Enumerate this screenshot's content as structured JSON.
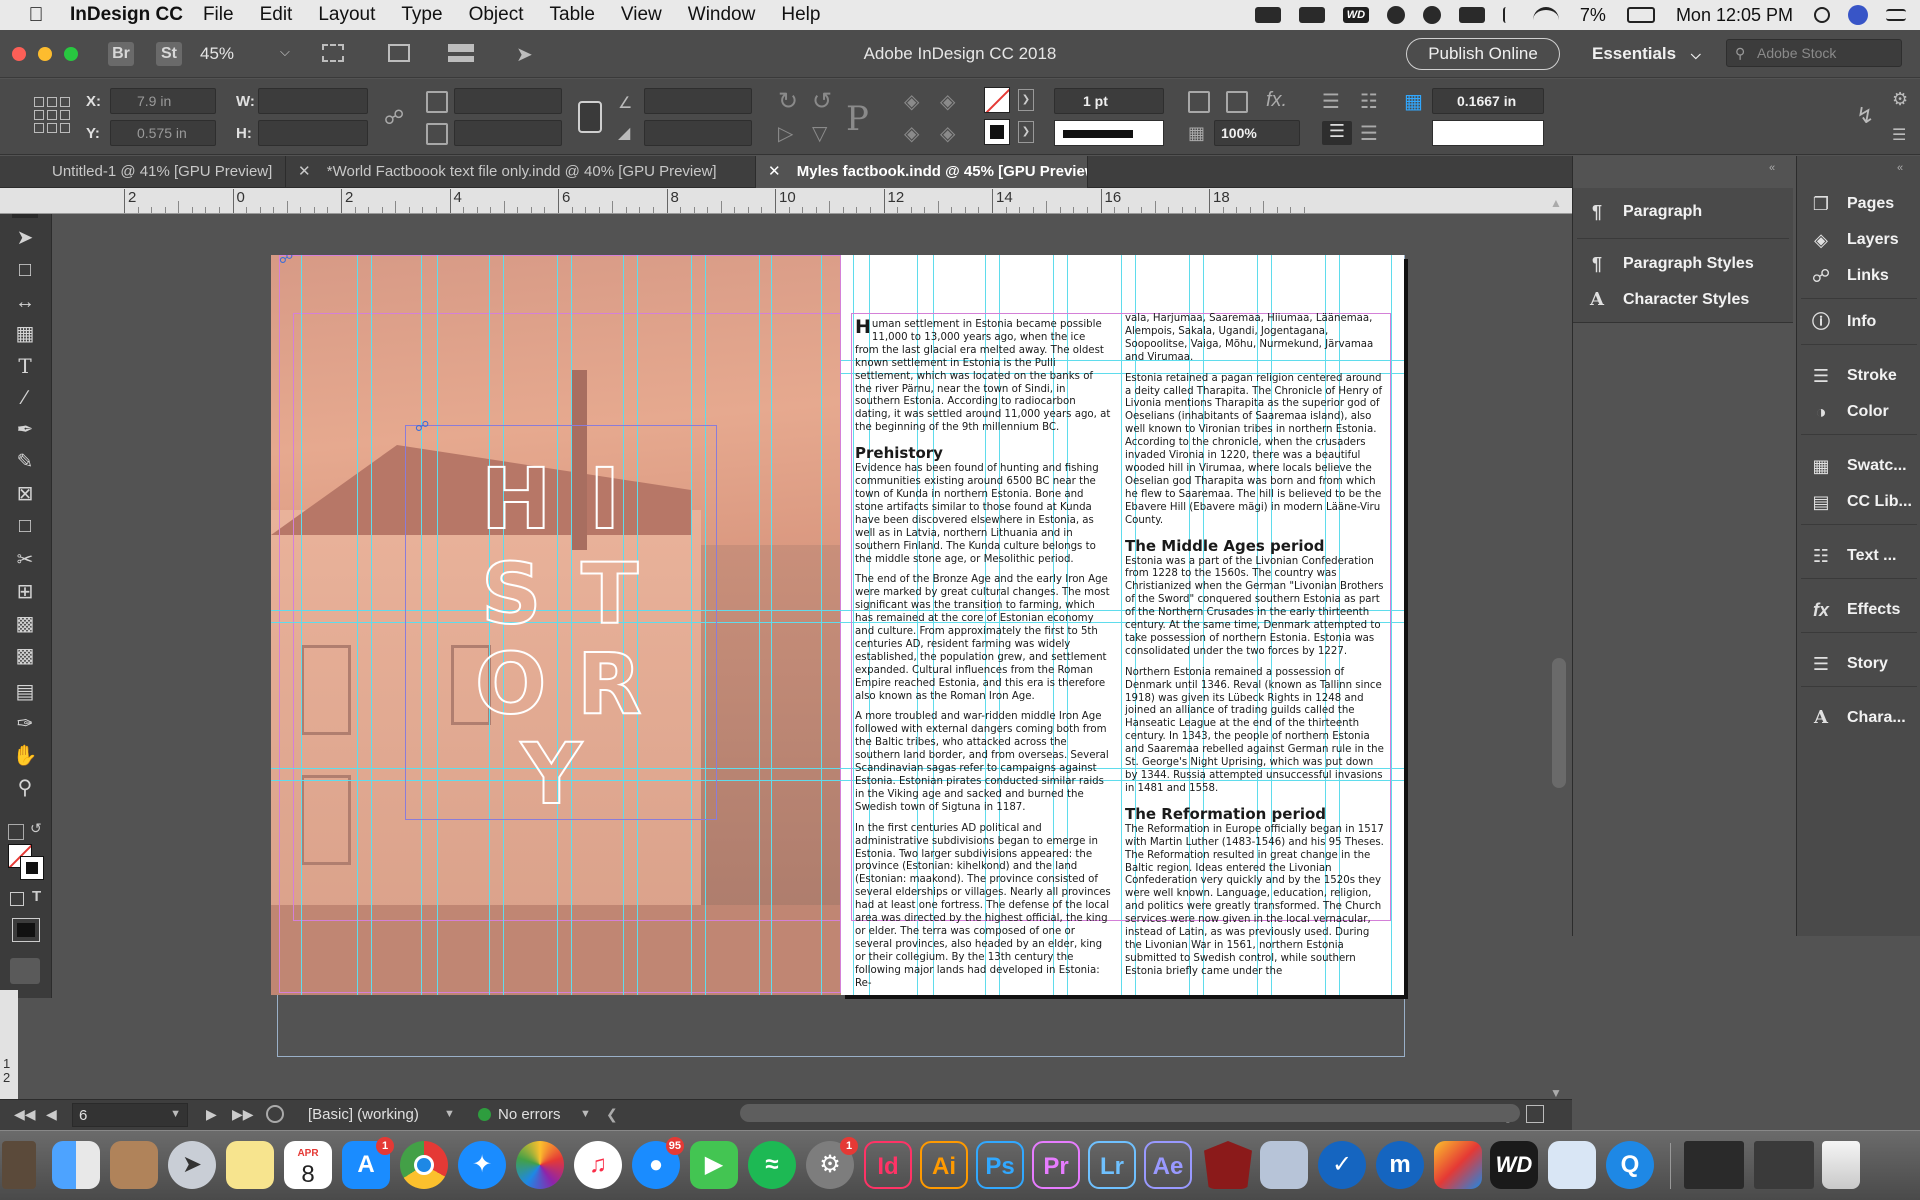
{
  "menubar": {
    "app_name": "InDesign CC",
    "items": [
      "File",
      "Edit",
      "Layout",
      "Type",
      "Object",
      "Table",
      "View",
      "Window",
      "Help"
    ],
    "battery": "7%",
    "clock": "Mon 12:05 PM",
    "wd_label": "WD"
  },
  "titlebar": {
    "bridge": "Br",
    "stock_btn": "St",
    "zoom": "45%",
    "title": "Adobe InDesign CC 2018",
    "publish": "Publish Online",
    "workspace": "Essentials",
    "search_placeholder": "Adobe Stock"
  },
  "control": {
    "x_label": "X:",
    "x_value": "7.9 in",
    "y_label": "Y:",
    "y_value": "0.575 in",
    "w_label": "W:",
    "h_label": "H:",
    "stroke_weight": "1 pt",
    "scale": "100%",
    "gutter": "0.1667 in"
  },
  "tabs": [
    {
      "label": "Untitled-1 @ 41% [GPU Preview]",
      "active": false
    },
    {
      "label": "*World Factboook text file only.indd @ 40% [GPU Preview]",
      "active": false
    },
    {
      "label": "Myles factbook.indd @ 45% [GPU Preview]",
      "active": true
    }
  ],
  "ruler": {
    "labels": [
      "2",
      "0",
      "2",
      "4",
      "6",
      "8",
      "10",
      "12",
      "14",
      "16",
      "18"
    ],
    "vertical_labels": [
      "1",
      "2"
    ]
  },
  "page": {
    "history_letters": [
      "H",
      "I",
      "S",
      "T",
      "O",
      "R",
      "Y"
    ],
    "col1": {
      "dropcap": "H",
      "intro": "uman settlement in Estonia became possible 11,000 to 13,000 years ago, when the ice from the last glacial era melted away. The oldest known settlement in Estonia is the Pulli settlement, which was located on the banks of the river Pärnu, near the town of Sindi, in southern Estonia. According to radiocarbon dating, it was settled around 11,000 years ago, at the beginning of the 9th millennium BC.",
      "h_prehistory": "Prehistory",
      "p1": "Evidence has been found of hunting and fishing communities existing around 6500 BC near the town of Kunda in northern Estonia. Bone and stone artifacts similar to those found at Kunda have been discovered elsewhere in Estonia, as well as in Latvia, northern Lithuania and in southern Finland. The Kunda culture belongs to the middle stone age, or Mesolithic period.",
      "p2": "The end of the Bronze Age and the early Iron Age were marked by great cultural changes. The most significant was the transition to farming, which has remained at the core of Estonian economy and culture. From approximately the first to 5th centuries AD, resident farming was widely established, the population grew, and settlement expanded. Cultural influences from the Roman Empire reached Estonia, and this era is therefore also known as the Roman Iron Age.",
      "p3": "A more troubled and war-ridden middle Iron Age followed with external dangers coming both from the Baltic tribes, who attacked across the southern land border, and from overseas. Several Scandinavian sagas refer to campaigns against Estonia. Estonian pirates conducted similar raids in the Viking age and sacked and burned the Swedish town of Sigtuna in 1187.",
      "p4": "In the first centuries AD political and administrative subdivisions began to emerge in Estonia. Two larger subdivisions appeared: the province (Estonian: kihelkond) and the land (Estonian: maakond). The province consisted of several elderships or villages. Nearly all provinces had at least one fortress. The defense of the local area was directed by the highest official, the king or elder. The terra was composed of one or several provinces, also headed by an elder, king or their collegium. By the 13th century the following major lands had developed in Estonia: Re-"
    },
    "col2": {
      "p0": "vala, Harjumaa, Saaremaa, Hiiumaa, Läänemaa, Alempois, Sakala, Ugandi, Jogentagana, Soopoolitse, Vaiga, Mõhu, Nurmekund, Järvamaa and Virumaa.",
      "p1": "Estonia retained a pagan religion centered around a deity called Tharapita. The Chronicle of Henry of Livonia mentions Tharapita as the superior god of Oeselians (inhabitants of Saaremaa island), also well known to Vironian tribes in northern Estonia. According to the chronicle, when the crusaders invaded Vironia in 1220, there was a beautiful wooded hill in Virumaa, where locals believe the Oeselian god Tharapita was born and from which he flew to Saaremaa. The hill is believed to be the Ebavere Hill (Ebavere mägi) in modern Lääne-Viru County.",
      "h_middle": "The Middle Ages period",
      "p2": "Estonia was a part of the Livonian Confederation from 1228 to the 1560s. The country was Christianized when the German \"Livonian Brothers of the Sword\" conquered southern Estonia as part of the Northern Crusades in the early thirteenth century. At the same time, Denmark attempted to take possession of northern Estonia. Estonia was consolidated under the two forces by 1227.",
      "p3": "Northern Estonia remained a possession of Denmark until 1346. Reval (known as Tallinn since 1918) was given its Lübeck Rights in 1248 and joined an alliance of trading guilds called the Hanseatic League at the end of the thirteenth century. In 1343, the people of northern Estonia and Saaremaa rebelled against German rule in the St. George's Night Uprising, which was put down by 1344. Russia attempted unsuccessful invasions in 1481 and 1558.",
      "h_reform": "The Reformation period",
      "p4": "The Reformation in Europe officially began in 1517 with Martin Luther (1483-1546) and his 95 Theses. The Reformation resulted in great change in the Baltic region. Ideas entered the Livonian Confederation very quickly and by the 1520s they were well known. Language, education, religion, and politics were greatly transformed. The Church services were now given in the local vernacular, instead of Latin, as was previously used. During the Livonian War in 1561, northern Estonia submitted to Swedish control, while southern Estonia briefly came under the"
    }
  },
  "panels": {
    "left": [
      {
        "icon": "paragraph-icon",
        "label": "Paragraph"
      },
      {
        "icon": "paragraph-styles-icon",
        "label": "Paragraph Styles"
      },
      {
        "icon": "character-styles-icon",
        "label": "Character Styles"
      }
    ],
    "right": [
      {
        "icon": "pages-icon",
        "label": "Pages"
      },
      {
        "icon": "layers-icon",
        "label": "Layers"
      },
      {
        "icon": "links-icon",
        "label": "Links"
      },
      {
        "icon": "info-icon",
        "label": "Info"
      },
      {
        "icon": "stroke-icon",
        "label": "Stroke"
      },
      {
        "icon": "color-icon",
        "label": "Color"
      },
      {
        "icon": "swatches-icon",
        "label": "Swatc..."
      },
      {
        "icon": "cc-libraries-icon",
        "label": "CC Lib..."
      },
      {
        "icon": "text-wrap-icon",
        "label": "Text ..."
      },
      {
        "icon": "effects-icon",
        "label": "Effects"
      },
      {
        "icon": "story-icon",
        "label": "Story"
      },
      {
        "icon": "character-icon",
        "label": "Chara..."
      }
    ]
  },
  "bottombar": {
    "page_number": "6",
    "style": "[Basic] (working)",
    "errors": "No errors"
  },
  "dock": {
    "calendar_month": "APR",
    "calendar_day": "8",
    "appstore_badge": "1",
    "messages_badge": "95",
    "prefs_badge": "1",
    "apps": [
      {
        "label": "Id",
        "color": "#49021f",
        "fg": "#ff3366"
      },
      {
        "label": "Ai",
        "color": "#330000",
        "fg": "#ff9a00"
      },
      {
        "label": "Ps",
        "color": "#001e36",
        "fg": "#31a8ff"
      },
      {
        "label": "Pr",
        "color": "#2a0634",
        "fg": "#e77cff"
      },
      {
        "label": "Lr",
        "color": "#001d34",
        "fg": "#6fc1ff"
      },
      {
        "label": "Ae",
        "color": "#00005b",
        "fg": "#9999ff"
      }
    ]
  },
  "colors": {
    "guide": "#5fdcec",
    "margin": "#d480d8",
    "overlay": "#e6a98f",
    "status_ok": "#2e9d3e"
  }
}
